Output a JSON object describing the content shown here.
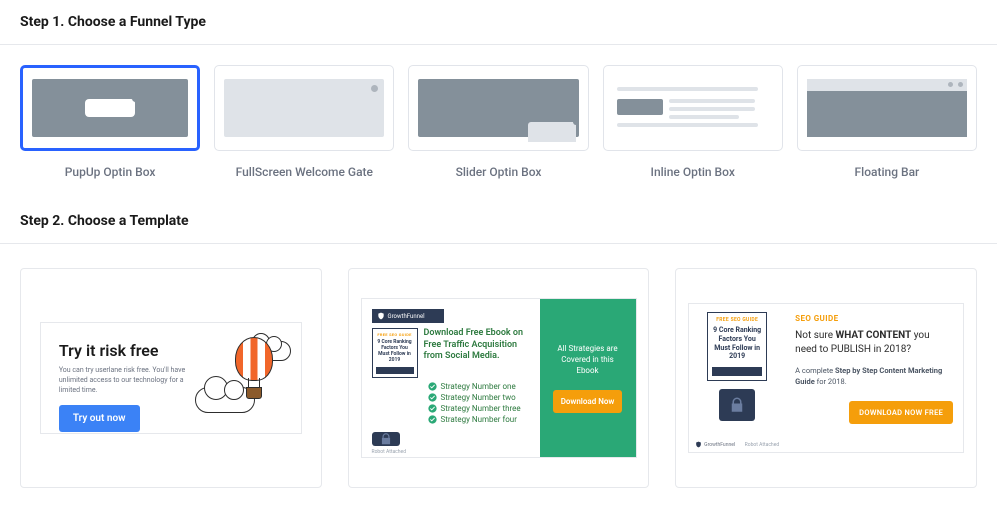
{
  "step1": {
    "title": "Step 1. Choose a Funnel Type",
    "types": [
      {
        "label": "PupUp Optin Box",
        "kind": "popup",
        "selected": true
      },
      {
        "label": "FullScreen Welcome Gate",
        "kind": "fullscreen",
        "selected": false
      },
      {
        "label": "Slider Optin Box",
        "kind": "slider",
        "selected": false
      },
      {
        "label": "Inline Optin Box",
        "kind": "inline",
        "selected": false
      },
      {
        "label": "Floating Bar",
        "kind": "floating",
        "selected": false
      }
    ]
  },
  "step2": {
    "title": "Step 2. Choose a Template",
    "templates": {
      "t1": {
        "title": "Try it risk free",
        "subtitle": "You can try userlane risk free. You'll have unlimited access to our technology for a limited time.",
        "cta": "Try out now"
      },
      "t2": {
        "brand": "GrowthFunnel",
        "booklet_top": "FREE SEO GUIDE",
        "booklet_mid": "9 Core Ranking Factors You Must Follow in 2019",
        "heading": "Download Free Ebook on Free Traffic Acquisition from Social Media.",
        "strategies": [
          "Strategy Number one",
          "Strategy Number two",
          "Strategy Number three",
          "Strategy Number four"
        ],
        "caption": "Robot Attached",
        "promo": "All Strategies are Covered in this Ebook",
        "cta": "Download Now"
      },
      "t3": {
        "booklet_top": "FREE SEO GUIDE",
        "booklet_mid": "9 Core Ranking Factors You Must Follow in 2019",
        "brand": "GrowthFunnel",
        "caption": "Robot Attached",
        "kicker": "SEO GUIDE",
        "headline_pre": "Not sure ",
        "headline_bold": "WHAT CONTENT",
        "headline_post": " you need to PUBLISH in 2018?",
        "sub_pre": "A complete ",
        "sub_bold": "Step by Step Content Marketing Guide",
        "sub_post": " for 2018.",
        "cta": "DOWNLOAD NOW FREE"
      }
    }
  }
}
